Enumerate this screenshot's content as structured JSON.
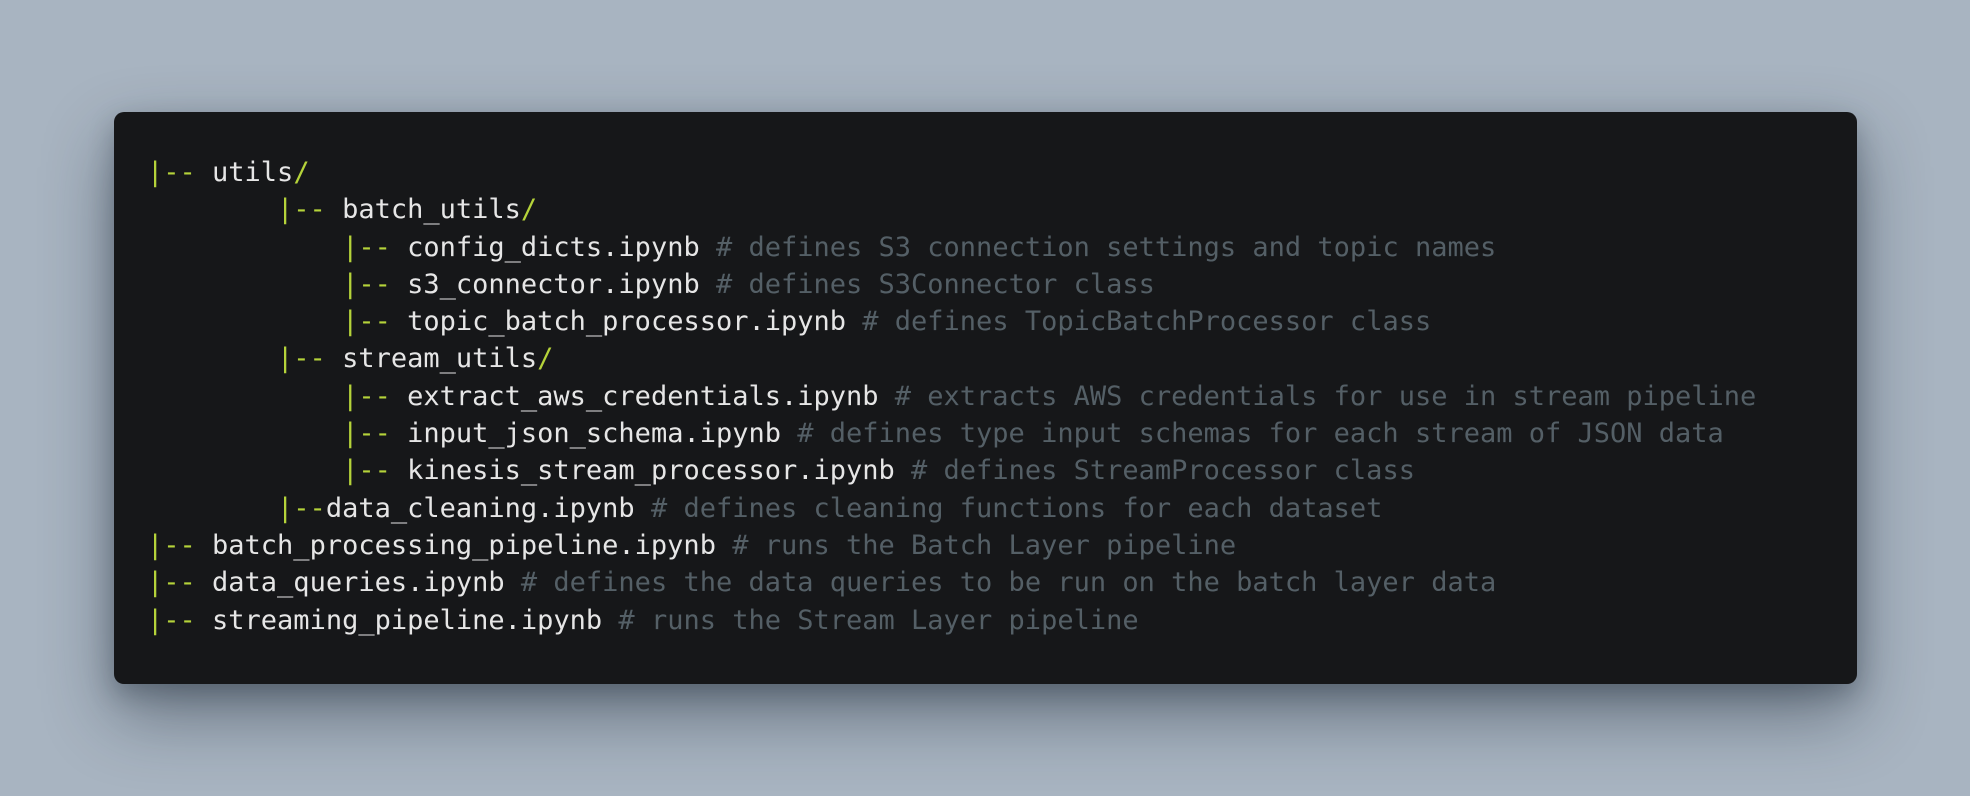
{
  "colors": {
    "background": "#a8b4c1",
    "window": "#161719",
    "branch": "#b5d33a",
    "filename": "#e6e6e6",
    "comment": "#545f66"
  },
  "tree": [
    {
      "indent": "",
      "branch": "|-- ",
      "name": "utils",
      "slash": "/",
      "comment": ""
    },
    {
      "indent": "        ",
      "branch": "|-- ",
      "name": "batch_utils",
      "slash": "/",
      "comment": ""
    },
    {
      "indent": "            ",
      "branch": "|-- ",
      "name": "config_dicts.ipynb",
      "slash": "",
      "comment": " # defines S3 connection settings and topic names"
    },
    {
      "indent": "            ",
      "branch": "|-- ",
      "name": "s3_connector.ipynb",
      "slash": "",
      "comment": " # defines S3Connector class"
    },
    {
      "indent": "            ",
      "branch": "|-- ",
      "name": "topic_batch_processor.ipynb",
      "slash": "",
      "comment": " # defines TopicBatchProcessor class"
    },
    {
      "indent": "        ",
      "branch": "|-- ",
      "name": "stream_utils",
      "slash": "/",
      "comment": ""
    },
    {
      "indent": "            ",
      "branch": "|-- ",
      "name": "extract_aws_credentials.ipynb",
      "slash": "",
      "comment": " # extracts AWS credentials for use in stream pipeline"
    },
    {
      "indent": "            ",
      "branch": "|-- ",
      "name": "input_json_schema.ipynb",
      "slash": "",
      "comment": " # defines type input schemas for each stream of JSON data"
    },
    {
      "indent": "            ",
      "branch": "|-- ",
      "name": "kinesis_stream_processor.ipynb",
      "slash": "",
      "comment": " # defines StreamProcessor class"
    },
    {
      "indent": "        ",
      "branch": "|--",
      "name": "data_cleaning.ipynb",
      "slash": "",
      "comment": " # defines cleaning functions for each dataset"
    },
    {
      "indent": "",
      "branch": "|-- ",
      "name": "batch_processing_pipeline.ipynb",
      "slash": "",
      "comment": " # runs the Batch Layer pipeline"
    },
    {
      "indent": "",
      "branch": "|-- ",
      "name": "data_queries.ipynb",
      "slash": "",
      "comment": " # defines the data queries to be run on the batch layer data"
    },
    {
      "indent": "",
      "branch": "|-- ",
      "name": "streaming_pipeline.ipynb",
      "slash": "",
      "comment": " # runs the Stream Layer pipeline"
    }
  ]
}
